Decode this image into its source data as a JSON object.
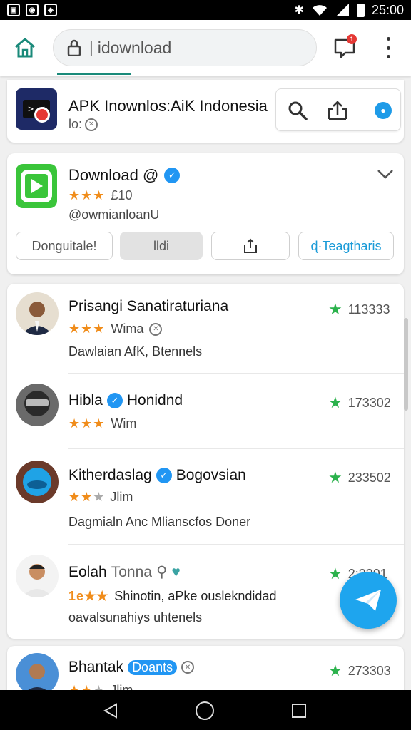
{
  "status_bar": {
    "time": "25:00",
    "left_icons": [
      "notification-icon",
      "app-icon",
      "app-icon"
    ],
    "right_icons": [
      "bluetooth-icon",
      "wifi-icon",
      "signal-icon",
      "battery-icon"
    ]
  },
  "url_bar": {
    "url": "idownload",
    "notification_count": "1"
  },
  "app_card": {
    "title": "APK Inownlos:AiK Indonesia",
    "subtitle": "lo:"
  },
  "featured": {
    "title": "Download @",
    "stars": "★★★",
    "rating": "£10",
    "handle": "@owmianloanU",
    "buttons": [
      "Donguitale!",
      "lldi",
      "",
      "ɖ·Teagtharis"
    ]
  },
  "list": [
    {
      "name": "Prisangi Sanatiraturiana",
      "verified": false,
      "stars": "★★★",
      "stars_empty": "",
      "rating": "Wima",
      "desc": "Dawlaian AfK, Btennels",
      "score": "113333"
    },
    {
      "name": "Hibla",
      "name2": "Honidnd",
      "verified": true,
      "stars": "★★★",
      "stars_empty": "",
      "rating": "Wim",
      "desc": "",
      "score": "173302"
    },
    {
      "name": "Kitherdaslag",
      "name2": "Bogovsian",
      "verified": true,
      "stars": "★★",
      "stars_empty": "★",
      "rating": "Jlim",
      "desc": "Dagmialn Anc Mlianscfos Doner",
      "score": "233502"
    },
    {
      "name": "Eolah",
      "name2": "Tonna",
      "verified": false,
      "stars": "1e★★",
      "stars_empty": "",
      "rating": "Shinotin, aPke ouslekndidad",
      "desc": "oavalsunahiys uhtenels",
      "score": "2:3301"
    },
    {
      "name": "Bhantak",
      "name2": "Doants",
      "verified": false,
      "stars": "★★",
      "stars_empty": "★",
      "rating": "Jlim",
      "desc": "",
      "score": "273303"
    }
  ],
  "colors": {
    "accent": "#1ea5ee",
    "star_orange": "#f08c1a",
    "star_green": "#2bb24c",
    "verified_blue": "#2196f3",
    "app_green": "#3ac53a",
    "app_navy": "#1e2a66"
  }
}
